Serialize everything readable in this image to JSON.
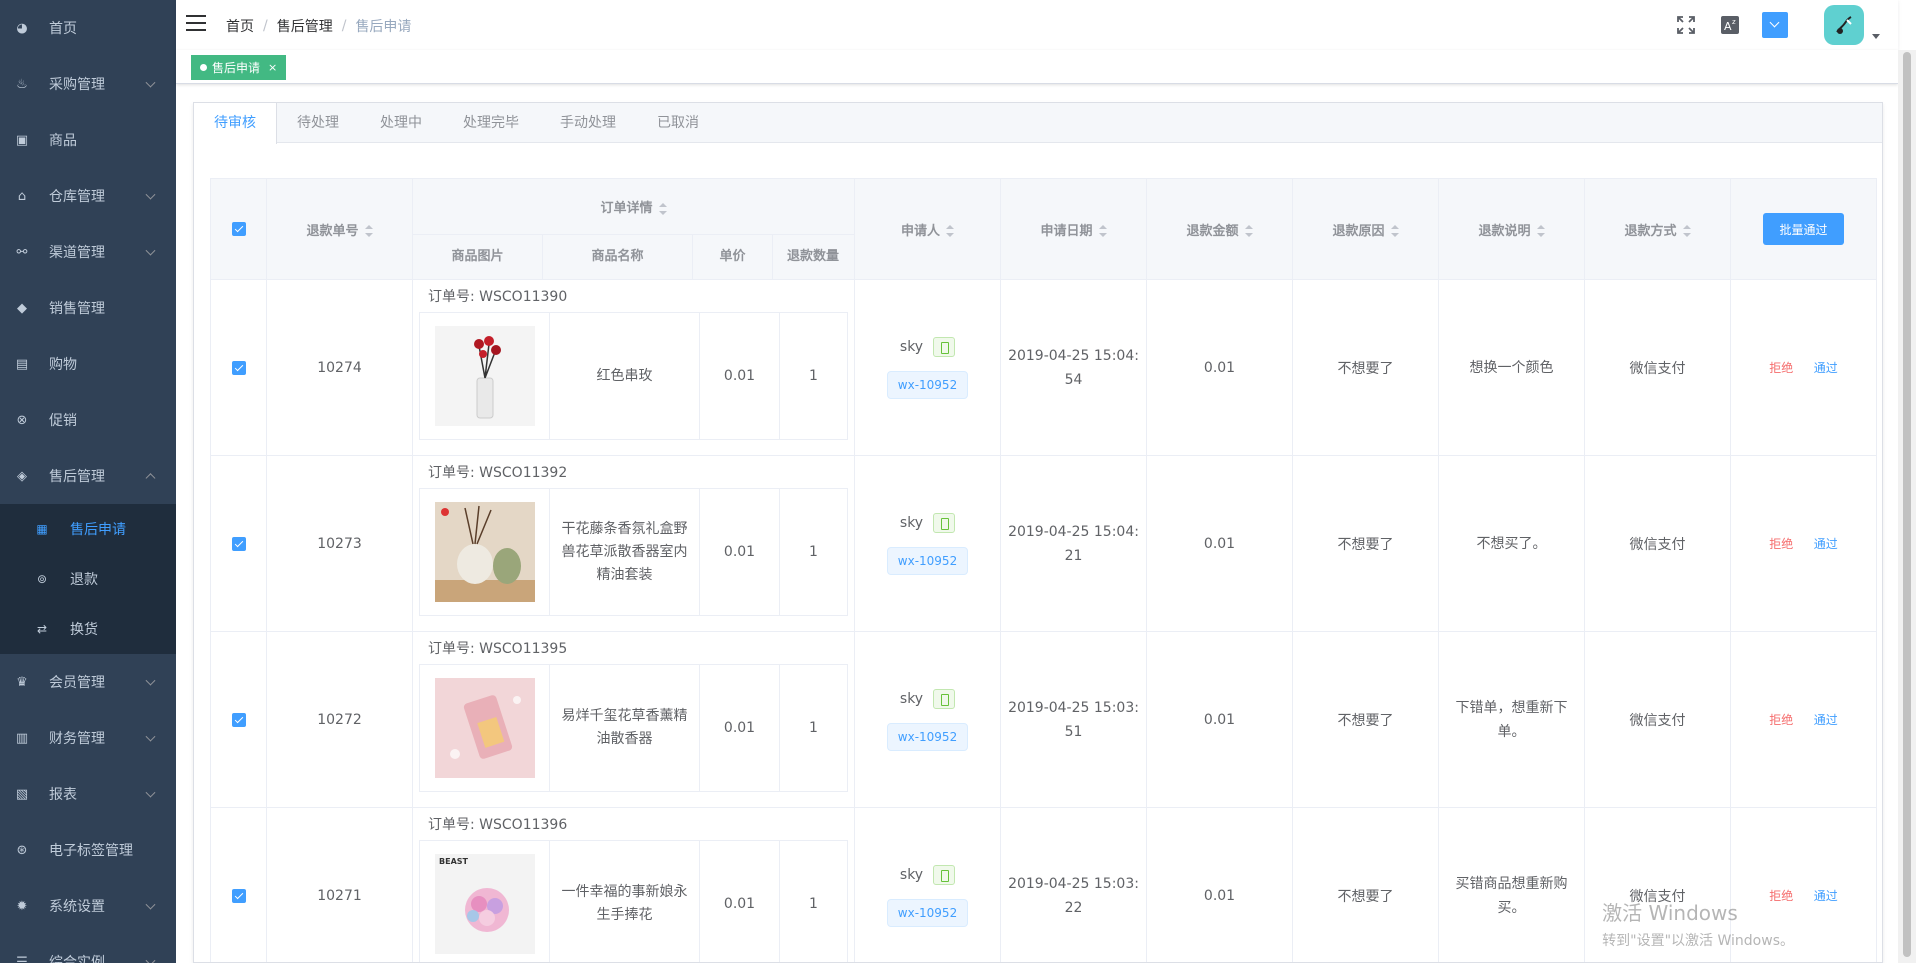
{
  "sidebar": {
    "items": [
      {
        "label": "首页",
        "icon": "dashboard-icon",
        "arrow": false
      },
      {
        "label": "采购管理",
        "icon": "basket-icon",
        "arrow": true
      },
      {
        "label": "商品",
        "icon": "bag-icon",
        "arrow": false
      },
      {
        "label": "仓库管理",
        "icon": "warehouse-icon",
        "arrow": true
      },
      {
        "label": "渠道管理",
        "icon": "hierarchy-icon",
        "arrow": true
      },
      {
        "label": "销售管理",
        "icon": "price-tag-icon",
        "arrow": false
      },
      {
        "label": "购物",
        "icon": "shop-icon",
        "arrow": false
      },
      {
        "label": "促销",
        "icon": "discount-icon",
        "arrow": false
      },
      {
        "label": "售后管理",
        "icon": "shield-icon",
        "arrow": "up"
      }
    ],
    "submenu": [
      {
        "label": "售后申请",
        "icon": "form-icon",
        "active": true
      },
      {
        "label": "退款",
        "icon": "coin-icon",
        "active": false
      },
      {
        "label": "换货",
        "icon": "exchange-icon",
        "active": false
      }
    ],
    "items2": [
      {
        "label": "会员管理",
        "icon": "crown-icon",
        "arrow": true
      },
      {
        "label": "财务管理",
        "icon": "bar-chart-icon",
        "arrow": true
      },
      {
        "label": "报表",
        "icon": "report-icon",
        "arrow": true
      },
      {
        "label": "电子标签管理",
        "icon": "label-icon",
        "arrow": false
      },
      {
        "label": "系统设置",
        "icon": "gear-icon",
        "arrow": true
      },
      {
        "label": "综合实例",
        "icon": "example-icon",
        "arrow": true
      }
    ]
  },
  "header": {
    "breadcrumb": [
      "首页",
      "售后管理",
      "售后申请"
    ],
    "separator": "/"
  },
  "tags": {
    "active": "售后申请",
    "close": "×"
  },
  "tabs": [
    "待审核",
    "待处理",
    "处理中",
    "处理完毕",
    "手动处理",
    "已取消"
  ],
  "table": {
    "headers": {
      "refund_no": "退款单号",
      "order_detail": "订单详情",
      "product_image": "商品图片",
      "product_name": "商品名称",
      "unit_price": "单价",
      "refund_qty": "退款数量",
      "applicant": "申请人",
      "apply_date": "申请日期",
      "refund_amount": "退款金额",
      "refund_reason": "退款原因",
      "refund_note": "退款说明",
      "refund_method": "退款方式",
      "batch_button": "批量通过"
    },
    "rows": [
      {
        "refund_no": "10274",
        "order_no": "订单号: WSCO11390",
        "product_name": "红色串玫",
        "unit_price": "0.01",
        "qty": "1",
        "applicant": "sky",
        "wx": "wx-10952",
        "date1": "2019-04-25 15:04:",
        "date2": "54",
        "amount": "0.01",
        "reason": "不想要了",
        "note": "想换一个颜色",
        "method": "微信支付",
        "reject": "拒绝",
        "pass": "通过"
      },
      {
        "refund_no": "10273",
        "order_no": "订单号: WSCO11392",
        "product_name": "干花藤条香氛礼盒野兽花草派散香器室内精油套装",
        "unit_price": "0.01",
        "qty": "1",
        "applicant": "sky",
        "wx": "wx-10952",
        "date1": "2019-04-25 15:04:",
        "date2": "21",
        "amount": "0.01",
        "reason": "不想要了",
        "note": "不想买了。",
        "method": "微信支付",
        "reject": "拒绝",
        "pass": "通过"
      },
      {
        "refund_no": "10272",
        "order_no": "订单号: WSCO11395",
        "product_name": "易烊千玺花草香薰精油散香器",
        "unit_price": "0.01",
        "qty": "1",
        "applicant": "sky",
        "wx": "wx-10952",
        "date1": "2019-04-25 15:03:",
        "date2": "51",
        "amount": "0.01",
        "reason": "不想要了",
        "note": "下错单，想重新下单。",
        "method": "微信支付",
        "reject": "拒绝",
        "pass": "通过"
      },
      {
        "refund_no": "10271",
        "order_no": "订单号: WSCO11396",
        "product_name": "一件幸福的事新娘永生手捧花",
        "unit_price": "0.01",
        "qty": "1",
        "applicant": "sky",
        "wx": "wx-10952",
        "date1": "2019-04-25 15:03:",
        "date2": "22",
        "amount": "0.01",
        "reason": "不想要了",
        "note": "买错商品想重新购买。",
        "method": "微信支付",
        "reject": "拒绝",
        "pass": "通过"
      }
    ]
  },
  "watermark": {
    "line1": "激活 Windows",
    "line2": "转到\"设置\"以激活 Windows。"
  },
  "colors": {
    "sidebar_bg": "#304156",
    "submenu_bg": "#1f2d3d",
    "primary": "#409eff",
    "danger": "#f56c6c",
    "tag_green": "#42b983"
  }
}
